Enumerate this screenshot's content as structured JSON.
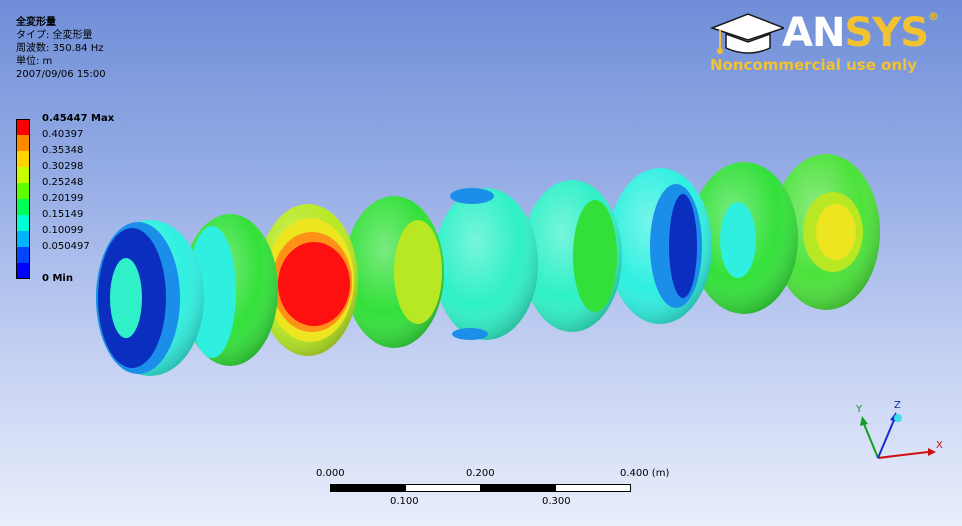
{
  "info": {
    "title": "全変形量",
    "type_line": "タイプ: 全変形量",
    "frequency_line": "周波数: 350.84 Hz",
    "unit_line": "単位: m",
    "date_line": "2007/09/06 15:00"
  },
  "legend": {
    "max_label": "0.45447 Max",
    "levels": [
      "0.40397",
      "0.35348",
      "0.30298",
      "0.25248",
      "0.20199",
      "0.15149",
      "0.10099",
      "0.050497"
    ],
    "min_label": "0 Min",
    "colors": [
      "#ff0000",
      "#ff8a00",
      "#ffd500",
      "#c8ff00",
      "#5cff00",
      "#00ff58",
      "#00ffd4",
      "#00b4ff",
      "#0046ff",
      "#0000ff"
    ]
  },
  "logo": {
    "brand_an": "AN",
    "brand_sys": "SYS",
    "registered": "®",
    "note": "Noncommercial use only"
  },
  "scale": {
    "top_labels": [
      "0.000",
      "0.200",
      "0.400 (m)"
    ],
    "bottom_labels": [
      "0.100",
      "0.300"
    ]
  },
  "triad": {
    "x_label": "X",
    "y_label": "Y",
    "z_label": "Z"
  },
  "colors": {
    "blue_dark": "#0a2fbf",
    "blue": "#1a8ee8",
    "cyan": "#2ff0e0",
    "green": "#33e03a",
    "yellow_green": "#b8e823",
    "yellow": "#ece51f",
    "orange": "#ff9018",
    "red": "#ff1010"
  }
}
